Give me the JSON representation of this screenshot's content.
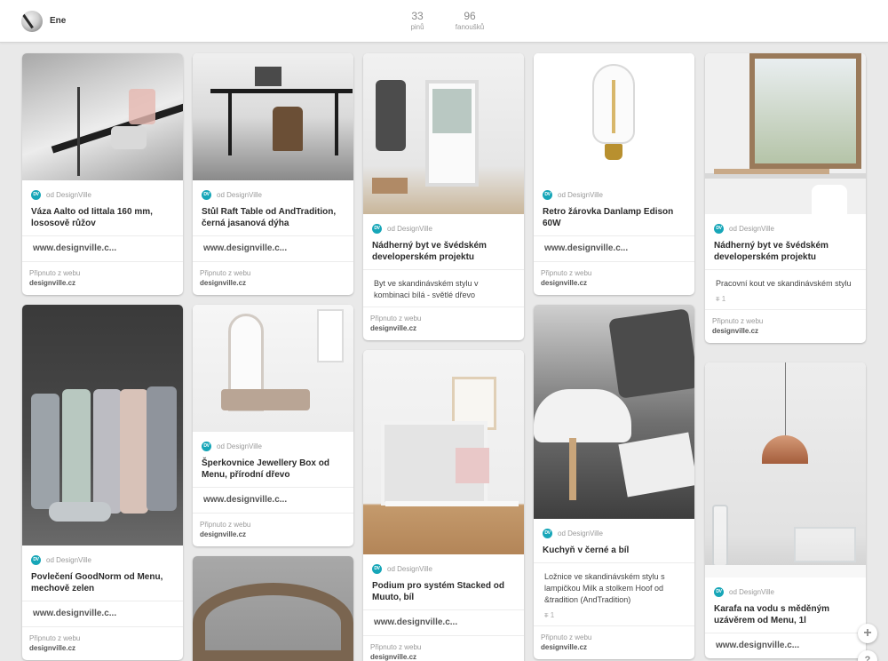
{
  "profile": {
    "name": "Ene"
  },
  "stats": {
    "pins": {
      "count": "33",
      "label": "pinů"
    },
    "fans": {
      "count": "96",
      "label": "fanoušků"
    }
  },
  "source_label": "od DesignVille",
  "source_badge": "DV",
  "footer_label": "Připnuto z webu",
  "footer_site": "designville.cz",
  "pins": [
    {
      "title": "Váza Aalto od Iittala 160 mm, lososově růžov",
      "link": "www.designville.c..."
    },
    {
      "title": "Povlečení GoodNorm od Menu, mechově zelen",
      "link": "www.designville.c..."
    },
    {
      "title": "Stůl Raft Table od AndTradition, černá jasanová dýha",
      "link": "www.designville.c..."
    },
    {
      "title": "Šperkovnice Jewellery Box od Menu, přírodní dřevo",
      "link": "www.designville.c..."
    },
    {
      "title": "Nádherný byt ve švédském developerském projektu",
      "desc": "Byt ve skandinávském stylu v kombinaci bílá - světlé dřevo"
    },
    {
      "title": "Podium pro systém Stacked od Muuto, bíl",
      "link": "www.designville.c..."
    },
    {
      "title": "Retro žárovka Danlamp Edison 60W",
      "link": "www.designville.c..."
    },
    {
      "title": "Kuchyň v černé a bíl",
      "desc": "Ložnice ve skandinávském stylu s lampičkou Milk a stolkem Hoof od &tradition (AndTradition)",
      "repins": "1"
    },
    {
      "title": "Nádherný byt ve švédském developerském projektu",
      "desc": "Pracovní kout ve skandinávském stylu",
      "repins": "1"
    },
    {
      "title": "Karafa na vodu s měděným uzávěrem od Menu, 1l",
      "link": "www.designville.c..."
    }
  ],
  "buttons": {
    "add": "+",
    "help": "?"
  },
  "colors": {
    "source_badge": "#17a6b8",
    "background": "#e9e9e9"
  }
}
